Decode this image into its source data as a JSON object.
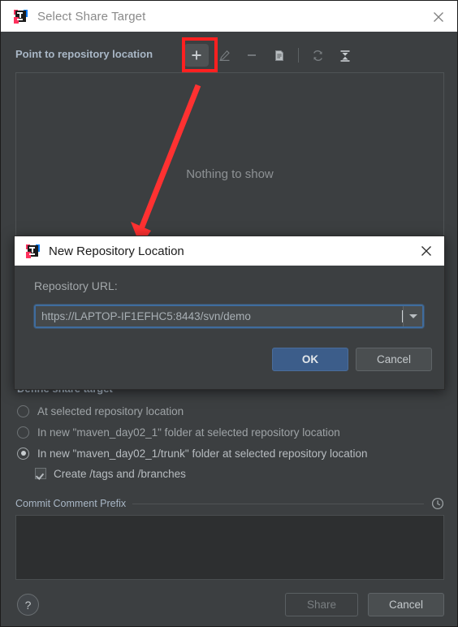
{
  "window": {
    "title": "Select Share Target",
    "icon": "intellij-idea-logo-icon",
    "close_icon": "close-icon"
  },
  "toolbar": {
    "label": "Point to repository location",
    "buttons": [
      {
        "name": "add-repository-location-button",
        "icon": "plus-icon",
        "state": "highlighted",
        "tooltip": "Add"
      },
      {
        "name": "edit-repository-location-button",
        "icon": "pencil-edit-icon",
        "state": "disabled"
      },
      {
        "name": "remove-repository-location-button",
        "icon": "minus-icon",
        "state": "disabled"
      },
      {
        "name": "details-button",
        "icon": "document-icon",
        "state": "disabled"
      },
      {
        "name": "refresh-button",
        "icon": "refresh-icon",
        "state": "disabled"
      },
      {
        "name": "collapse-all-button",
        "icon": "collapse-all-icon",
        "state": "enabled"
      }
    ]
  },
  "tree_panel": {
    "empty_text": "Nothing to show"
  },
  "define_share_target": {
    "header": "Define share target",
    "options": [
      {
        "label": "At selected repository location",
        "selected": false
      },
      {
        "label": "In new \"maven_day02_1\" folder at selected repository location",
        "selected": false
      },
      {
        "label": "In new \"maven_day02_1/trunk\" folder at selected repository location",
        "selected": true
      }
    ],
    "checkbox": {
      "label": "Create /tags and /branches",
      "checked": true
    }
  },
  "commit_comment_prefix": {
    "label": "Commit Comment Prefix",
    "history_icon": "clock-history-icon",
    "value": ""
  },
  "footer": {
    "help_label": "?",
    "share_label": "Share",
    "cancel_label": "Cancel"
  },
  "new_repository_dialog": {
    "title": "New Repository Location",
    "icon": "intellij-idea-logo-icon",
    "close_icon": "close-icon",
    "url_label": "Repository URL:",
    "url_value": "https://LAPTOP-IF1EFHC5:8443/svn/demo",
    "url_placeholder": "",
    "dropdown_icon": "chevron-down-icon",
    "ok_label": "OK",
    "cancel_label": "Cancel"
  },
  "annotations": {
    "highlight_color": "#ff2020",
    "arrow_color": "#ff3131",
    "highlight_target": "add-repository-location-button",
    "arrow_points_to": "new-repository-location-dialog"
  },
  "colors": {
    "dialog_bg": "#3c3f41",
    "titlebar_bg": "#ffffff",
    "text_primary": "#a9b7c6",
    "text_muted": "#9ea3a6",
    "accent_button": "#3c5d8a",
    "field_bg": "#45494b",
    "field_focus_border": "#3f6c9e",
    "textarea_bg": "#2d2f30"
  }
}
